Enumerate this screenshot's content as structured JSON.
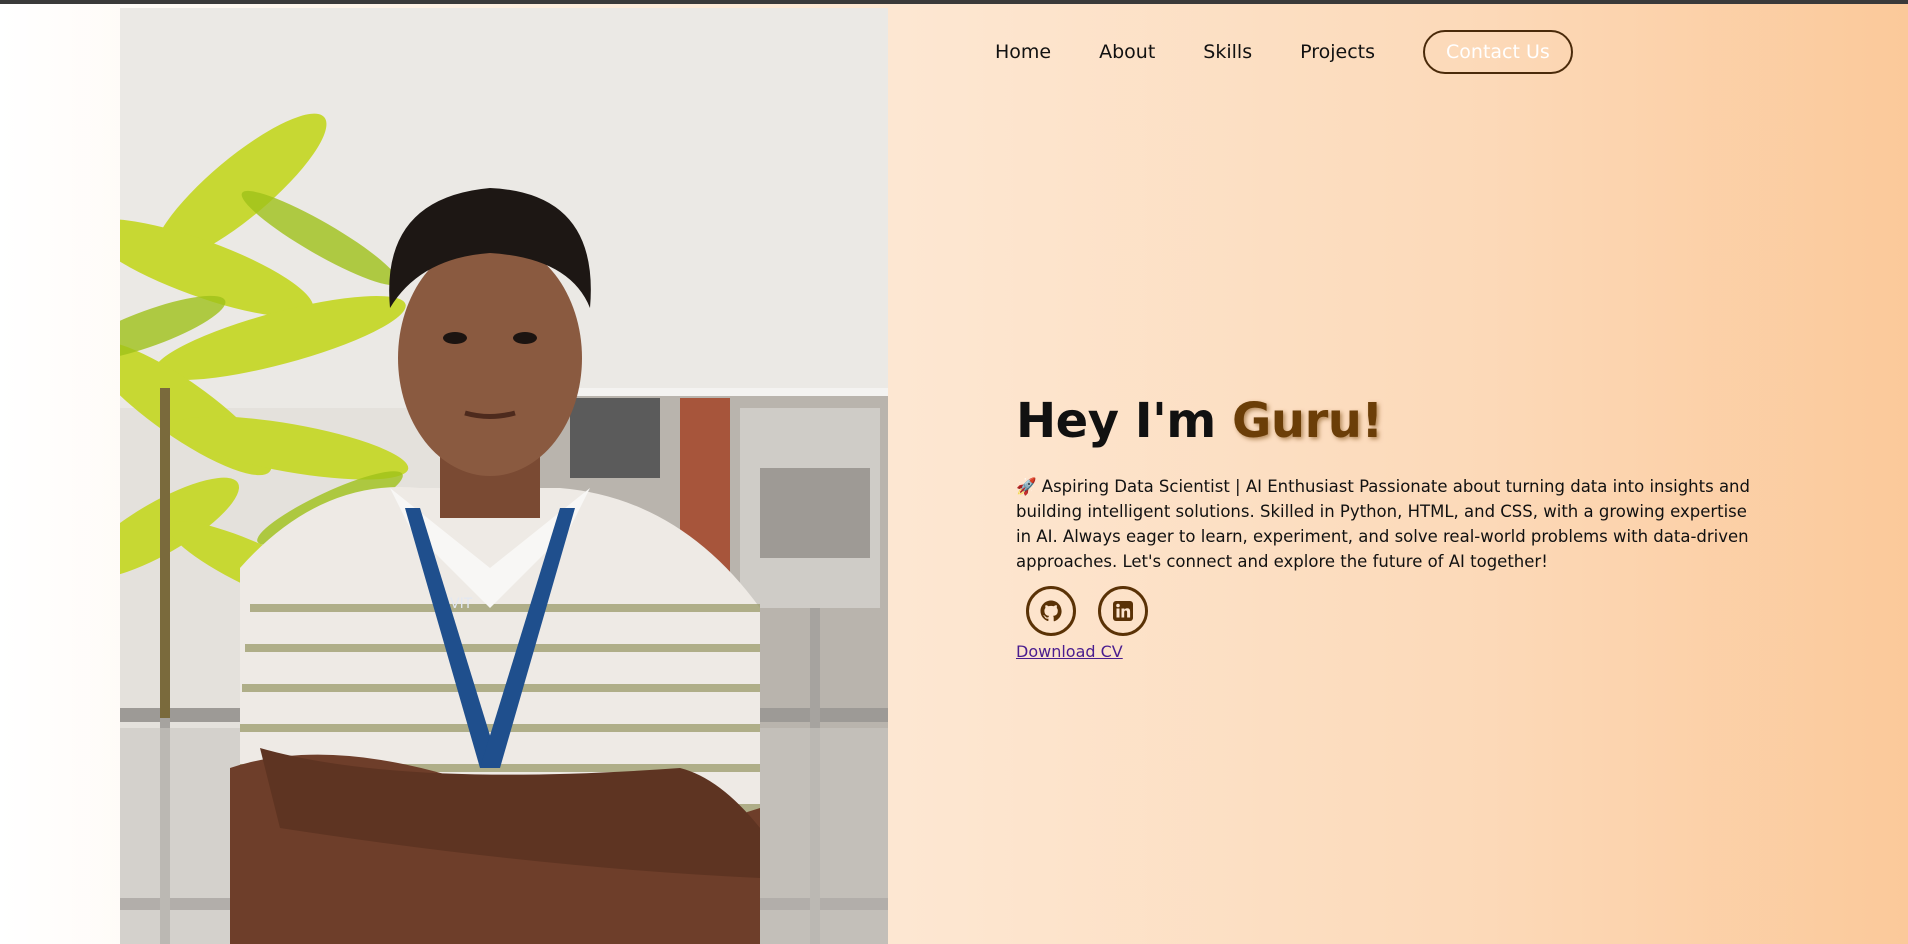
{
  "nav": {
    "items": [
      {
        "label": "Home"
      },
      {
        "label": "About"
      },
      {
        "label": "Skills"
      },
      {
        "label": "Projects"
      }
    ],
    "contact_label": "Contact Us"
  },
  "hero": {
    "greeting": "Hey I'm ",
    "name": "Guru!",
    "emoji": "🚀",
    "description": "Aspiring Data Scientist | AI Enthusiast Passionate about turning data into insights and building intelligent solutions. Skilled in Python, HTML, and CSS, with a growing expertise in AI. Always eager to learn, experiment, and solve real-world problems with data-driven approaches. Let's connect and explore the future of AI together!",
    "socials": [
      {
        "icon": "github-icon"
      },
      {
        "icon": "linkedin-icon"
      }
    ],
    "download_label": "Download CV"
  },
  "photo": {
    "lanyard_text": "VIT"
  },
  "colors": {
    "accent": "#6b3e08",
    "button_border": "#4a2a0a",
    "link": "#4a1d8f",
    "bg_start": "#ffffff",
    "bg_end": "#fbc99a"
  }
}
